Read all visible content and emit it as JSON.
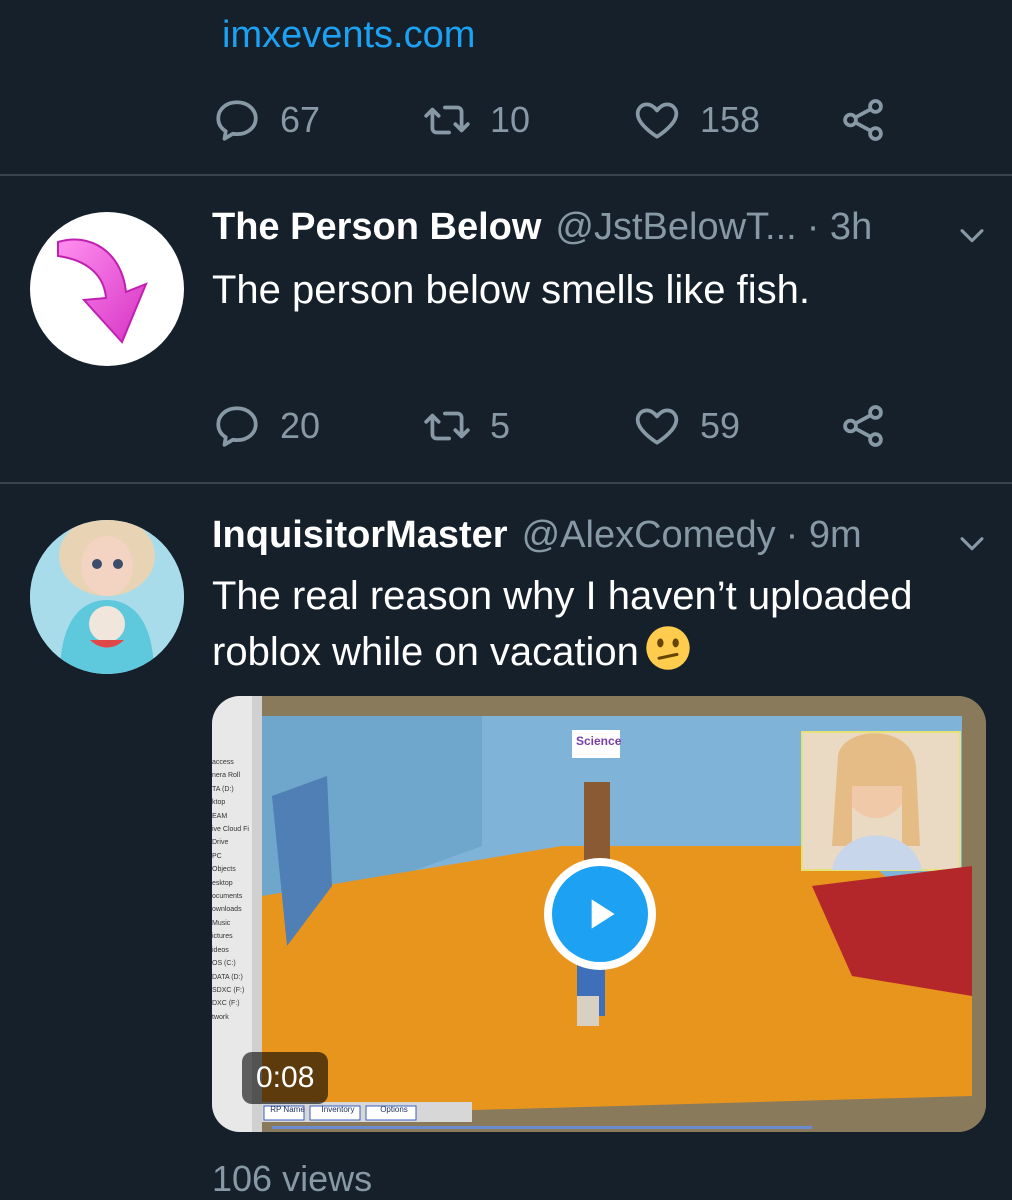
{
  "prev_tweet": {
    "link": "imxevents.com",
    "replies": "67",
    "retweets": "10",
    "likes": "158"
  },
  "tweets": [
    {
      "name": "The Person Below",
      "handle": "@JstBelowT...",
      "time": "· 3h",
      "text": "The person below smells like fish.",
      "replies": "20",
      "retweets": "5",
      "likes": "59"
    },
    {
      "name": "InquisitorMaster",
      "handle": "@AlexComedy",
      "time": "· 9m",
      "text_line1": "The real reason why I haven’t uploaded",
      "text_line2": "roblox while on vacation",
      "emoji": "confused-face",
      "video": {
        "duration": "0:08",
        "sign": "Science",
        "tabs": [
          "RP Name",
          "Inventory",
          "Options"
        ],
        "sidebar": [
          "access",
          "nera Roll",
          "TA (D:)",
          "ktop",
          "EAM",
          "ive Cloud Fi",
          "Drive",
          "PC",
          "Objects",
          "esktop",
          "ocuments",
          "ownloads",
          "Music",
          "ictures",
          "ideos",
          "OS (C:)",
          "DATA (D:)",
          "SDXC (F:)",
          "DXC (F:)",
          "twork"
        ]
      },
      "views": "106 views"
    }
  ],
  "colors": {
    "background": "#15202b",
    "accent": "#1da1f2",
    "muted": "#8899a6",
    "divider": "#38444d"
  },
  "icons": [
    "reply-icon",
    "retweet-icon",
    "like-icon",
    "share-icon",
    "chevron-down-icon",
    "play-icon"
  ]
}
